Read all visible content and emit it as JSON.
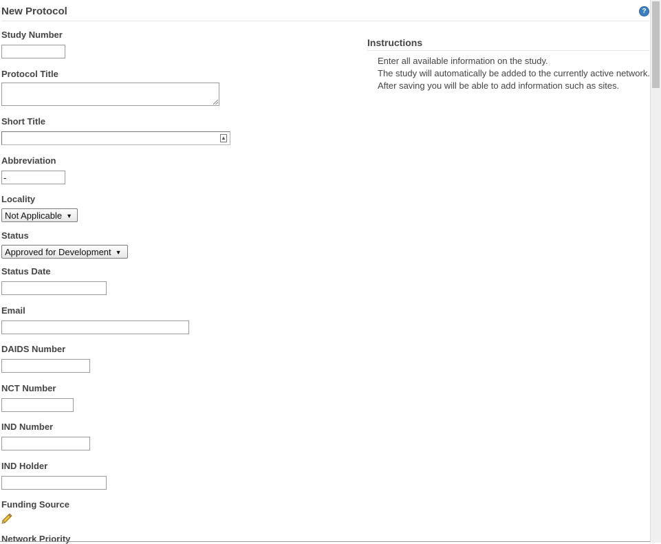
{
  "header": {
    "title": "New Protocol",
    "help_icon": "help-icon",
    "help_glyph": "?"
  },
  "form": {
    "study_number": {
      "label": "Study Number",
      "value": ""
    },
    "protocol_title": {
      "label": "Protocol Title",
      "value": ""
    },
    "short_title": {
      "label": "Short Title",
      "value": "",
      "icon": "contact-card-icon"
    },
    "abbreviation": {
      "label": "Abbreviation",
      "value": "-"
    },
    "locality": {
      "label": "Locality",
      "selected": "Not Applicable"
    },
    "status": {
      "label": "Status",
      "selected": "Approved for Development"
    },
    "status_date": {
      "label": "Status Date",
      "value": ""
    },
    "email": {
      "label": "Email",
      "value": ""
    },
    "daids_number": {
      "label": "DAIDS Number",
      "value": ""
    },
    "nct_number": {
      "label": "NCT Number",
      "value": ""
    },
    "ind_number": {
      "label": "IND Number",
      "value": ""
    },
    "ind_holder": {
      "label": "IND Holder",
      "value": ""
    },
    "funding_source": {
      "label": "Funding Source",
      "edit_icon": "pencil-icon"
    },
    "network_priority": {
      "label": "Network Priority"
    }
  },
  "instructions": {
    "title": "Instructions",
    "lines": [
      "Enter all available information on the study.",
      "The study will automatically be added to the currently active network.",
      "After saving you will be able to add information such as sites."
    ]
  },
  "colors": {
    "label": "#444444",
    "border": "#9a9a9a",
    "help_icon": "#3a7fc6"
  }
}
